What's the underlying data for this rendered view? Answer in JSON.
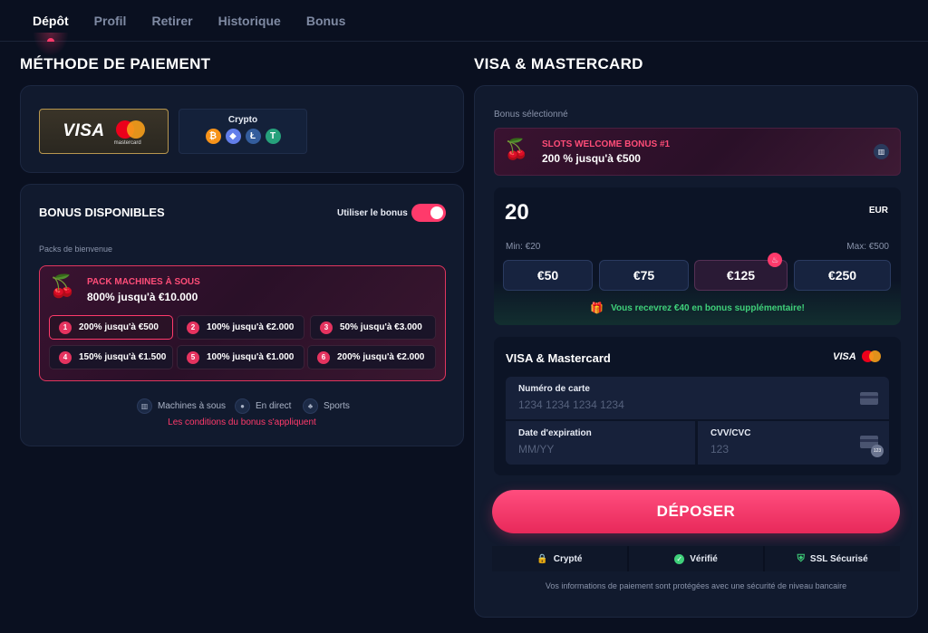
{
  "tabs": [
    {
      "label": "Dépôt",
      "active": true
    },
    {
      "label": "Profil"
    },
    {
      "label": "Retirer"
    },
    {
      "label": "Historique"
    },
    {
      "label": "Bonus"
    }
  ],
  "left": {
    "payment_title": "MÉTHODE DE PAIEMENT",
    "methods": {
      "visa_text": "VISA",
      "mastercard_text": "mastercard",
      "crypto_label": "Crypto",
      "crypto_coins": [
        {
          "symbol": "₿",
          "color": "#f7931a"
        },
        {
          "symbol": "◆",
          "color": "#627eea"
        },
        {
          "symbol": "Ł",
          "color": "#345d9d"
        },
        {
          "symbol": "T",
          "color": "#26a17b"
        }
      ]
    },
    "bonus": {
      "title": "BONUS DISPONIBLES",
      "use_bonus_label": "Utiliser le bonus",
      "use_bonus_on": true,
      "packs_label": "Packs de bienvenue",
      "pack_title": "PACK MACHINES À SOUS",
      "pack_sub": "800% jusqu'à €10.000",
      "tiers": [
        {
          "n": "1",
          "text": "200% jusqu'à €500",
          "selected": true
        },
        {
          "n": "2",
          "text": "100% jusqu'à €2.000"
        },
        {
          "n": "3",
          "text": "50% jusqu'à €3.000"
        },
        {
          "n": "4",
          "text": "150% jusqu'à €1.500"
        },
        {
          "n": "5",
          "text": "100% jusqu'à €1.000"
        },
        {
          "n": "6",
          "text": "200% jusqu'à €2.000"
        }
      ],
      "categories": [
        "Machines à sous",
        "En direct",
        "Sports"
      ],
      "conditions": "Les conditions du bonus s'appliquent"
    }
  },
  "right": {
    "title": "VISA & MASTERCARD",
    "selected_bonus_label": "Bonus sélectionné",
    "selected_bonus_title": "SLOTS WELCOME BONUS #1",
    "selected_bonus_sub": "200 % jusqu'à €500",
    "amount": "20",
    "currency": "EUR",
    "min": "Min: €20",
    "max": "Max: €500",
    "quick_amounts": [
      {
        "label": "€50"
      },
      {
        "label": "€75"
      },
      {
        "label": "€125",
        "hot": true
      },
      {
        "label": "€250"
      }
    ],
    "bonus_note": "Vous recevrez €40 en bonus supplémentaire!",
    "card_section_title": "VISA & Mastercard",
    "card_logo_visa": "VISA",
    "card_number_label": "Numéro de carte",
    "card_number_placeholder": "1234 1234 1234 1234",
    "expiry_label": "Date d'expiration",
    "expiry_placeholder": "MM/YY",
    "cvv_label": "CVV/CVC",
    "cvv_placeholder": "123",
    "cvv_badge": "123",
    "deposit_label": "DÉPOSER",
    "trust": [
      "Crypté",
      "Vérifié",
      "SSL Sécurisé"
    ],
    "security_note": "Vos informations de paiement sont protégées avec une sécurité de niveau bancaire"
  },
  "colors": {
    "accent": "#ff3a6b",
    "bg": "#0a1020",
    "panel": "#111a2e",
    "success": "#3fd07a"
  }
}
